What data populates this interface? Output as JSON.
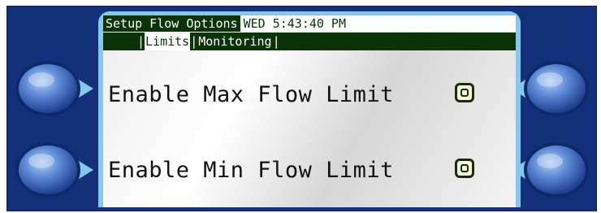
{
  "header": {
    "title": "Setup Flow Options",
    "datetime": "WED 5:43:40 PM"
  },
  "tabs": {
    "separator": "|",
    "items": [
      {
        "label": "Limits",
        "selected": true
      },
      {
        "label": "Monitoring",
        "selected": false
      }
    ]
  },
  "options": [
    {
      "label": "Enable Max Flow Limit",
      "checked": false
    },
    {
      "label": "Enable Min Flow Limit",
      "checked": false
    }
  ],
  "colors": {
    "bezel": "#15307a",
    "screen_frame": "#86c7ec",
    "lcd_dark": "#0b3308",
    "button": "#4a76c8"
  },
  "icons": {
    "softkeys": "round-blue-softkey-button"
  }
}
